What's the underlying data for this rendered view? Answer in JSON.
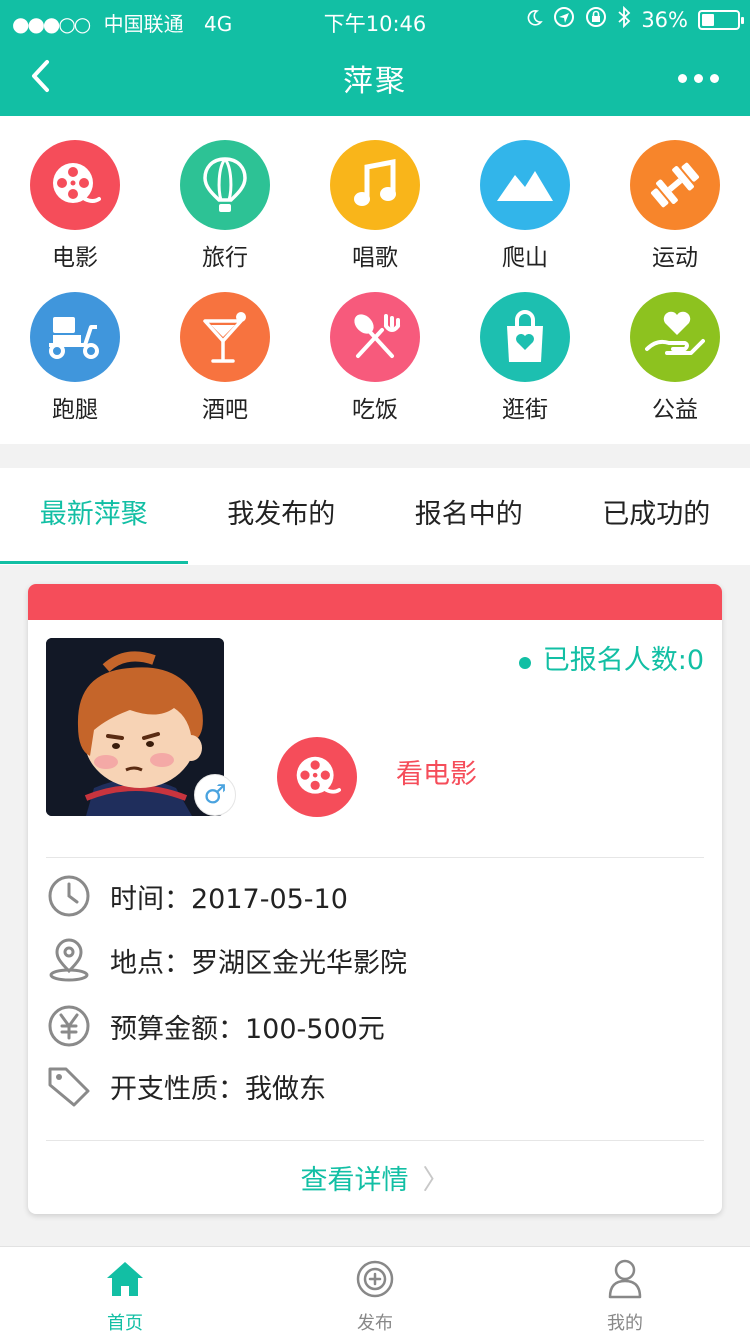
{
  "status_bar": {
    "signal_dots": "●●●○○",
    "carrier": "中国联通",
    "network": "4G",
    "time": "下午10:46",
    "battery_percent": "36%",
    "battery_level": 0.36
  },
  "nav": {
    "title": "萍聚"
  },
  "categories": [
    {
      "label": "电影",
      "icon": "film-reel-icon",
      "color": "#f54d5a"
    },
    {
      "label": "旅行",
      "icon": "hot-air-balloon-icon",
      "color": "#2dc295"
    },
    {
      "label": "唱歌",
      "icon": "music-note-icon",
      "color": "#f9b51a"
    },
    {
      "label": "爬山",
      "icon": "mountain-icon",
      "color": "#32b5ea"
    },
    {
      "label": "运动",
      "icon": "dumbbell-icon",
      "color": "#f7852b"
    },
    {
      "label": "跑腿",
      "icon": "scooter-icon",
      "color": "#4096dc"
    },
    {
      "label": "酒吧",
      "icon": "cocktail-glass-icon",
      "color": "#f7733f"
    },
    {
      "label": "吃饭",
      "icon": "fork-spoon-icon",
      "color": "#f75a7c"
    },
    {
      "label": "逛街",
      "icon": "shopping-bag-icon",
      "color": "#1dbfb0"
    },
    {
      "label": "公益",
      "icon": "heart-hand-icon",
      "color": "#8dc21f"
    }
  ],
  "tabs": [
    {
      "label": "最新萍聚",
      "active": true
    },
    {
      "label": "我发布的",
      "active": false
    },
    {
      "label": "报名中的",
      "active": false
    },
    {
      "label": "已成功的",
      "active": false
    }
  ],
  "card": {
    "signup_count": "已报名人数:0",
    "gender_symbol": "♂",
    "event_name": "看电影",
    "time_text": "时间：2017-05-10",
    "location_text": "地点：罗湖区金光华影院",
    "budget_text": "预算金额：100-500元",
    "expense_text": "开支性质：我做东",
    "details_label": "查看详情",
    "details_chevron": "〉"
  },
  "tabbar": [
    {
      "label": "首页",
      "icon": "home-icon",
      "active": true
    },
    {
      "label": "发布",
      "icon": "publish-icon",
      "active": false
    },
    {
      "label": "我的",
      "icon": "user-icon",
      "active": false
    }
  ],
  "colors": {
    "brand": "#12bfa4",
    "accent_red": "#f54d5a"
  }
}
